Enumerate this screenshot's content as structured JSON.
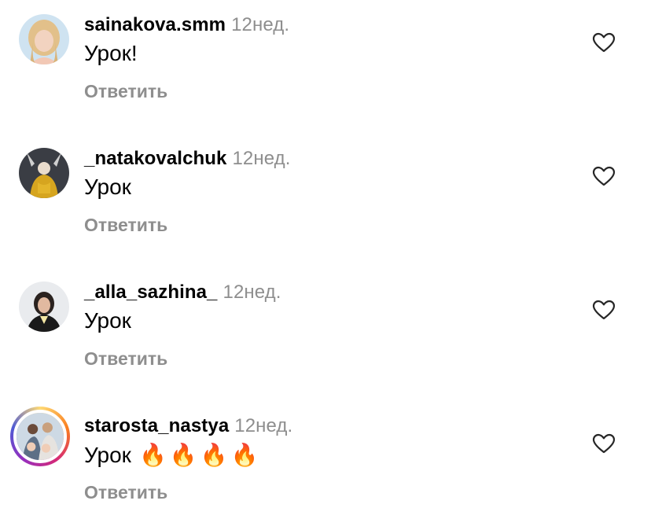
{
  "comments": [
    {
      "username": "sainakova.smm",
      "time": "12нед.",
      "text": "Урок!",
      "emoji": "",
      "reply_label": "Ответить",
      "avatar_icon": "avatar-blonde-woman",
      "like_icon": "heart-outline-icon",
      "has_story_ring": false
    },
    {
      "username": "_natakovalchuk",
      "time": "12нед.",
      "text": "Урок",
      "emoji": "",
      "reply_label": "Ответить",
      "avatar_icon": "avatar-yellow-figure",
      "like_icon": "heart-outline-icon",
      "has_story_ring": false
    },
    {
      "username": "_alla_sazhina_",
      "time": "12нед.",
      "text": "Урок",
      "emoji": "",
      "reply_label": "Ответить",
      "avatar_icon": "avatar-dark-hair-woman",
      "like_icon": "heart-outline-icon",
      "has_story_ring": false
    },
    {
      "username": "starosta_nastya",
      "time": "12нед.",
      "text": "Урок",
      "emoji": "🔥🔥🔥🔥",
      "reply_label": "Ответить",
      "avatar_icon": "avatar-family-photo",
      "like_icon": "heart-outline-icon",
      "has_story_ring": true
    }
  ],
  "colors": {
    "secondary_text": "#8e8e8e",
    "primary_text": "#000000",
    "background": "#ffffff"
  }
}
